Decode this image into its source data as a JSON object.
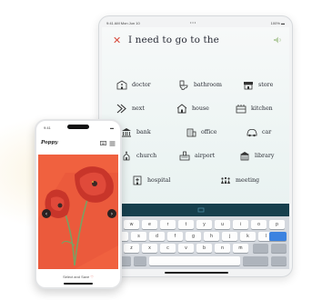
{
  "tablet": {
    "status_time": "9:41 AM  Mon Jun 10",
    "status_dots": "•••",
    "battery": "100% ▬",
    "phrase": "I need to go to the",
    "words": [
      {
        "label": "doctor",
        "icon": "doctor-building-icon"
      },
      {
        "label": "bathroom",
        "icon": "toilet-icon"
      },
      {
        "label": "store",
        "icon": "store-icon"
      },
      {
        "label": "next",
        "icon": "next-arrow-icon"
      },
      {
        "label": "house",
        "icon": "house-icon"
      },
      {
        "label": "kitchen",
        "icon": "kitchen-icon"
      },
      {
        "label": "bank",
        "icon": "bank-icon"
      },
      {
        "label": "office",
        "icon": "office-icon"
      },
      {
        "label": "car",
        "icon": "car-icon"
      },
      {
        "label": "church",
        "icon": "church-icon"
      },
      {
        "label": "airport",
        "icon": "airport-icon"
      },
      {
        "label": "library",
        "icon": "library-icon"
      },
      {
        "label": "hospital",
        "icon": "hospital-icon"
      },
      {
        "label": "meeting",
        "icon": "meeting-icon"
      }
    ],
    "keyboard": {
      "row1": [
        "q",
        "w",
        "e",
        "r",
        "t",
        "y",
        "u",
        "i",
        "o",
        "p"
      ],
      "row2": [
        "a",
        "s",
        "d",
        "f",
        "g",
        "h",
        "j",
        "k",
        "l"
      ],
      "row3": [
        "z",
        "x",
        "c",
        "v",
        "b",
        "n",
        "m"
      ]
    },
    "colors": {
      "accent": "#d84a3c",
      "keyboard_bar": "#163f4d"
    }
  },
  "phone": {
    "status_time": "9:41",
    "battery": "▬",
    "title": "Poppy",
    "footer": "Select and Save",
    "footer_heart": "♡",
    "colors": {
      "background": "#f0613f"
    }
  }
}
